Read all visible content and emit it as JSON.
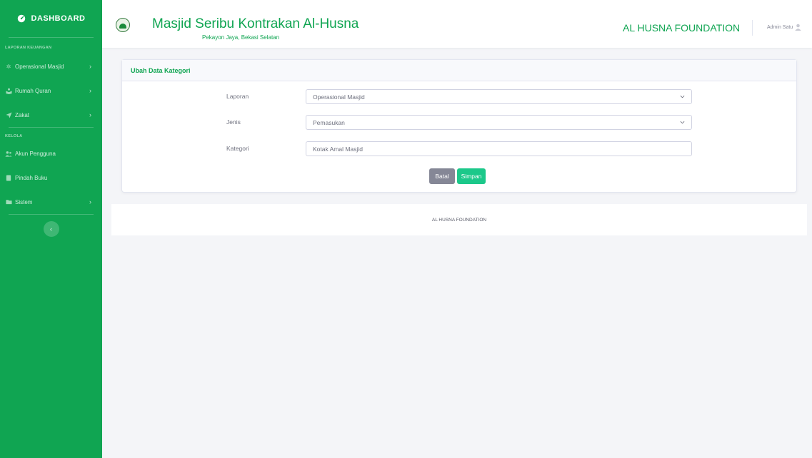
{
  "sidebar": {
    "brand": "DASHBOARD",
    "section_laporan": "LAPORAN KEUANGAN",
    "section_kelola": "KELOLA",
    "items": [
      {
        "label": "Operasional Masjid",
        "icon": "gear-icon",
        "has_chevron": true
      },
      {
        "label": "Rumah Quran",
        "icon": "book-reader-icon",
        "has_chevron": true
      },
      {
        "label": "Zakat",
        "icon": "paper-plane-icon",
        "has_chevron": true
      },
      {
        "label": "Akun Pengguna",
        "icon": "users-icon",
        "has_chevron": false
      },
      {
        "label": "Pindah Buku",
        "icon": "book-icon",
        "has_chevron": false
      },
      {
        "label": "Sistem",
        "icon": "folder-icon",
        "has_chevron": true
      }
    ],
    "chevron": "›",
    "toggle": "‹"
  },
  "header": {
    "title": "Masjid Seribu Kontrakan Al-Husna",
    "subtitle": "Pekayon Jaya, Bekasi Selatan",
    "foundation": "AL HUSNA FOUNDATION",
    "user": "Admin Satu"
  },
  "form": {
    "title": "Ubah Data Kategori",
    "laporan_label": "Laporan",
    "laporan_value": "Operasional Masjid",
    "jenis_label": "Jenis",
    "jenis_value": "Pemasukan",
    "kategori_label": "Kategori",
    "kategori_value": "Kotak Amal Masjid",
    "cancel_label": "Batal",
    "save_label": "Simpan"
  },
  "footer": {
    "text": "AL HUSNA FOUNDATION"
  },
  "colors": {
    "brand_green": "#10a552",
    "success": "#1cc88a",
    "secondary": "#858796"
  }
}
